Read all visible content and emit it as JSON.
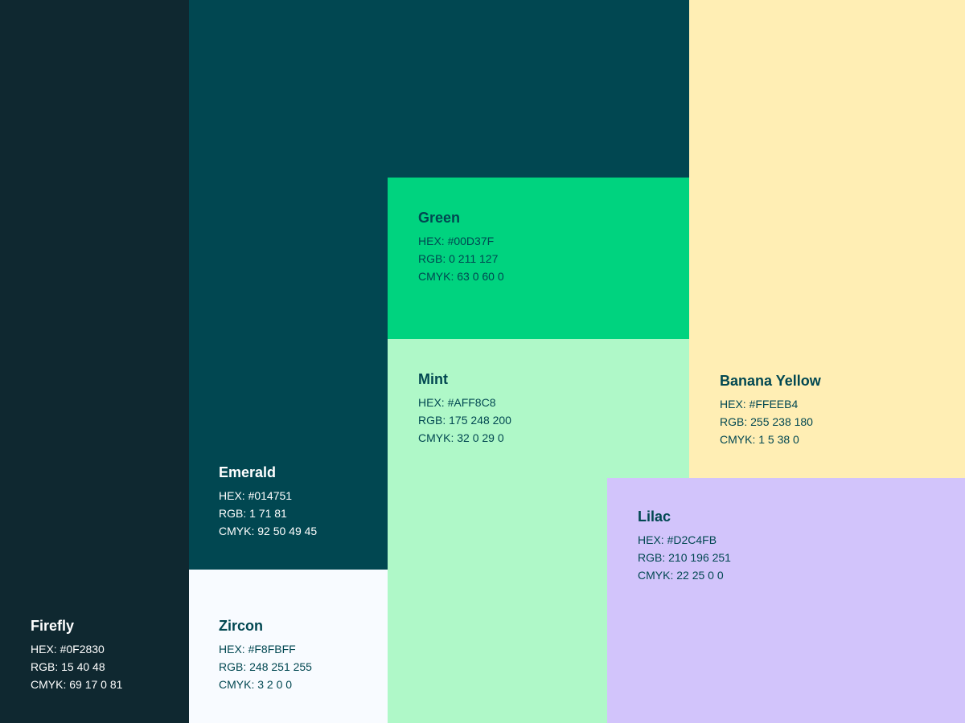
{
  "swatches": {
    "firefly": {
      "name": "Firefly",
      "hex": "HEX: #0F2830",
      "rgb": "RGB: 15 40 48",
      "cmyk": "CMYK: 69 17 0 81",
      "color": "#0F2830",
      "text_color": "#FFFFFF"
    },
    "emerald": {
      "name": "Emerald",
      "hex": "HEX: #014751",
      "rgb": "RGB: 1 71 81",
      "cmyk": "CMYK: 92 50 49 45",
      "color": "#014751",
      "text_color": "#FFFFFF"
    },
    "zircon": {
      "name": "Zircon",
      "hex": "HEX: #F8FBFF",
      "rgb": "RGB: 248 251 255",
      "cmyk": "CMYK: 3 2 0 0",
      "color": "#F8FBFF",
      "text_color": "#014751"
    },
    "green": {
      "name": "Green",
      "hex": "HEX: #00D37F",
      "rgb": "RGB: 0 211 127",
      "cmyk": "CMYK: 63 0 60 0",
      "color": "#00D37F",
      "text_color": "#014751"
    },
    "mint": {
      "name": "Mint",
      "hex": "HEX: #AFF8C8",
      "rgb": "RGB: 175 248 200",
      "cmyk": "CMYK: 32 0 29 0",
      "color": "#AFF8C8",
      "text_color": "#014751"
    },
    "banana": {
      "name": "Banana Yellow",
      "hex": "HEX: #FFEEB4",
      "rgb": "RGB: 255 238 180",
      "cmyk": "CMYK: 1 5 38 0",
      "color": "#FFEEB4",
      "text_color": "#014751"
    },
    "lilac": {
      "name": "Lilac",
      "hex": "HEX: #D2C4FB",
      "rgb": "RGB: 210 196 251",
      "cmyk": "CMYK: 22 25 0 0",
      "color": "#D2C4FB",
      "text_color": "#014751"
    }
  }
}
